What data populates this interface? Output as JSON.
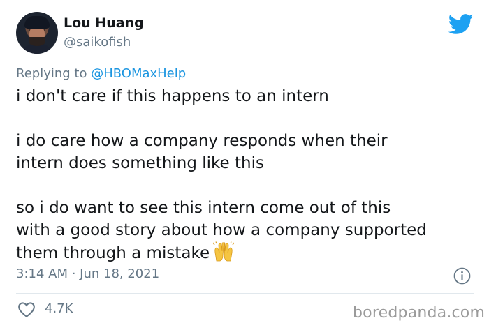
{
  "author": {
    "name": "Lou Huang",
    "handle": "@saikofish"
  },
  "reply": {
    "prefix": "Replying to ",
    "mention": "@HBOMaxHelp"
  },
  "tweet": {
    "paragraph1": "i don't care if this happens to an intern",
    "paragraph2_line1": "i do care how a company responds when their",
    "paragraph2_line2": "intern does something like this",
    "paragraph3_line1": "so i do want to see this intern come out of this",
    "paragraph3_line2": "with a good story about how a company supported",
    "paragraph3_line3": "them through a mistake",
    "emoji": "raising-hands-emoji"
  },
  "meta": {
    "timestamp": "3:14 AM · Jun 18, 2021",
    "likes": "4.7K"
  },
  "watermark": "boredpanda.com",
  "icons": {
    "brand": "twitter-bird-icon",
    "info": "info-icon",
    "like": "heart-icon"
  },
  "colors": {
    "twitter_blue": "#1da1f2",
    "mention_blue": "#1b95e0",
    "secondary_text": "#657786",
    "primary_text": "#14171a"
  }
}
